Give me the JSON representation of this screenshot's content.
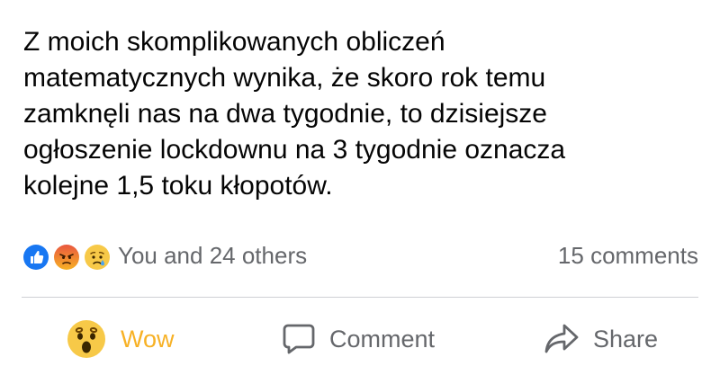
{
  "post": {
    "lines": [
      "Z moich skomplikowanych obliczeń",
      "matematycznych wynika, że skoro rok temu",
      "zamknęli nas na dwa tygodnie, to dzisiejsze",
      "ogłoszenie lockdownu na 3 tygodnie oznacza",
      "kolejne 1,5 toku kłopotów."
    ]
  },
  "reactions": {
    "icons": [
      "like-icon",
      "angry-icon",
      "sad-icon"
    ],
    "summary": "You and 24 others",
    "comments": "15 comments"
  },
  "actions": {
    "wow": {
      "label": "Wow",
      "icon": "wow-icon",
      "color": "#f7b125"
    },
    "comment": {
      "label": "Comment",
      "icon": "comment-icon"
    },
    "share": {
      "label": "Share",
      "icon": "share-icon"
    }
  },
  "colors": {
    "text": "#050505",
    "secondary": "#65676b",
    "like_blue": "#1877f2",
    "divider": "#ced0d4"
  }
}
